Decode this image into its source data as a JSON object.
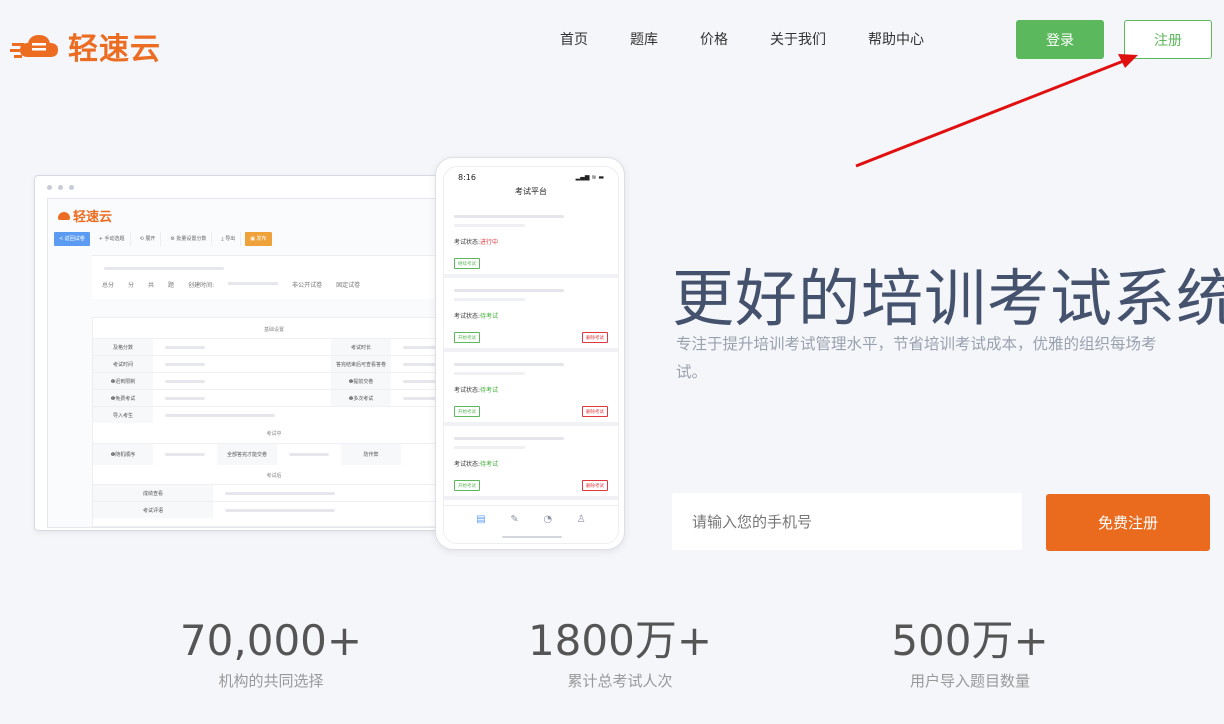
{
  "header": {
    "logo_text": "轻速云",
    "nav": [
      "首页",
      "题库",
      "价格",
      "关于我们",
      "帮助中心"
    ],
    "login_label": "登录",
    "register_label": "注册"
  },
  "desktop_mock": {
    "logo_text": "轻速云",
    "toolbar": [
      "< 返回试卷",
      "+ 手动选题",
      "⟲ 展开",
      "⚙ 批量设置分数",
      "⤓ 导出",
      "▣ 发布"
    ],
    "summary": [
      "总分",
      "分",
      "共",
      "题",
      "创建时间:",
      "非公开试卷",
      "固定试卷"
    ],
    "section_basic": "基础设置",
    "basic_rows": [
      [
        "及格分数",
        "考试时长"
      ],
      [
        "考试时间",
        "答完结束后可查看答卷"
      ],
      [
        "❶迟到限制",
        "❶提前交卷"
      ],
      [
        "❶免费考试",
        "❶多次考试"
      ],
      [
        "导入考生",
        ""
      ]
    ],
    "section_during": "考试中",
    "during_row": [
      "❶随机顺序",
      "全部答完才能交卷",
      "防作弊"
    ],
    "section_after": "考试后",
    "after_rows": [
      "成绩查看",
      "考试评语"
    ]
  },
  "phone_mock": {
    "time": "8:16",
    "status_icons": "▂▄▆ ≋ ▬",
    "title": "考试平台",
    "cards": [
      {
        "status_label": "考试状态:",
        "status_value": "进行中",
        "primary_btn": "继续考试",
        "secondary_btn": ""
      },
      {
        "status_label": "考试状态:",
        "status_value": "待考试",
        "primary_btn": "开始考试",
        "secondary_btn": "删除考试"
      },
      {
        "status_label": "考试状态:",
        "status_value": "待考试",
        "primary_btn": "开始考试",
        "secondary_btn": "删除考试"
      },
      {
        "status_label": "考试状态:",
        "status_value": "待考试",
        "primary_btn": "开始考试",
        "secondary_btn": "删除考试"
      }
    ]
  },
  "hero": {
    "title": "更好的培训考试系统",
    "subtitle": "专注于提升培训考试管理水平，节省培训考试成本，优雅的组织每场考试。",
    "input_placeholder": "请输入您的手机号",
    "cta_label": "免费注册"
  },
  "stats": [
    {
      "number": "70,000+",
      "label": "机构的共同选择"
    },
    {
      "number": "1800万+",
      "label": "累计总考试人次"
    },
    {
      "number": "500万+",
      "label": "用户导入题目数量"
    }
  ],
  "colors": {
    "brand_orange": "#ea6a1e",
    "login_green": "#5cb85c",
    "title_navy": "#44526d",
    "annotation_arrow": "#e01010"
  }
}
